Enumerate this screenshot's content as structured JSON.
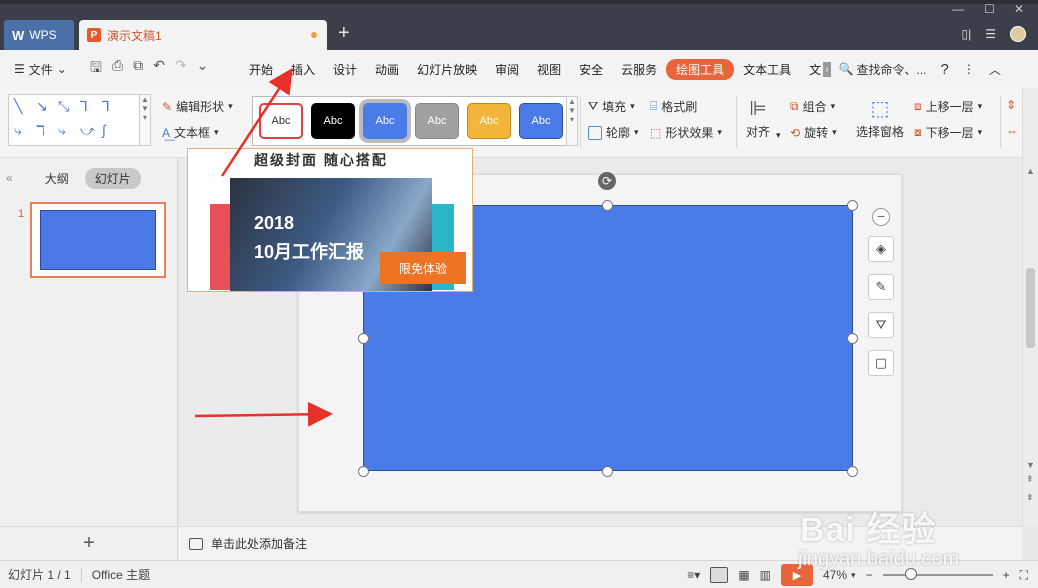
{
  "titlebar": {
    "home_tab": "WPS",
    "doc_tab": "演示文稿1",
    "new_tab_symbol": "+"
  },
  "menubar": {
    "file_label": "文件",
    "items": [
      "开始",
      "插入",
      "设计",
      "动画",
      "幻灯片放映",
      "审阅",
      "视图",
      "安全",
      "云服务",
      "绘图工具",
      "文本工具",
      "文"
    ],
    "active_item": "绘图工具",
    "search_label": "查找命令、...",
    "help_label": "?"
  },
  "ribbon": {
    "edit_shape": "编辑形状",
    "text_box": "文本框",
    "styles": [
      "Abc",
      "Abc",
      "Abc",
      "Abc",
      "Abc",
      "Abc"
    ],
    "fill": "填充",
    "outline": "轮廓",
    "format_painter": "格式刷",
    "shape_effects": "形状效果",
    "align": "对齐",
    "group": "组合",
    "rotate": "旋转",
    "selection_pane": "选择窗格",
    "bring_forward": "上移一层",
    "send_backward": "下移一层"
  },
  "left_panel": {
    "outline_tab": "大纲",
    "slides_tab": "幻灯片",
    "slide_number": "1",
    "add_symbol": "+"
  },
  "ad_popup": {
    "title": "超级封面 随心搭配",
    "year": "2018",
    "headline": "10月工作汇报",
    "button": "限免体验"
  },
  "notes": {
    "placeholder": "单击此处添加备注"
  },
  "statusbar": {
    "slide_info": "幻灯片 1 / 1",
    "theme": "Office 主题",
    "zoom": "47%",
    "zoom_fraction": 0.47
  },
  "watermark": {
    "text": "Bai 经验",
    "url": "jingyan.baidu.com"
  },
  "colors": {
    "accent": "#e8643a",
    "shape_fill": "#4a7be6",
    "wps_tab": "#4b6fa7"
  }
}
